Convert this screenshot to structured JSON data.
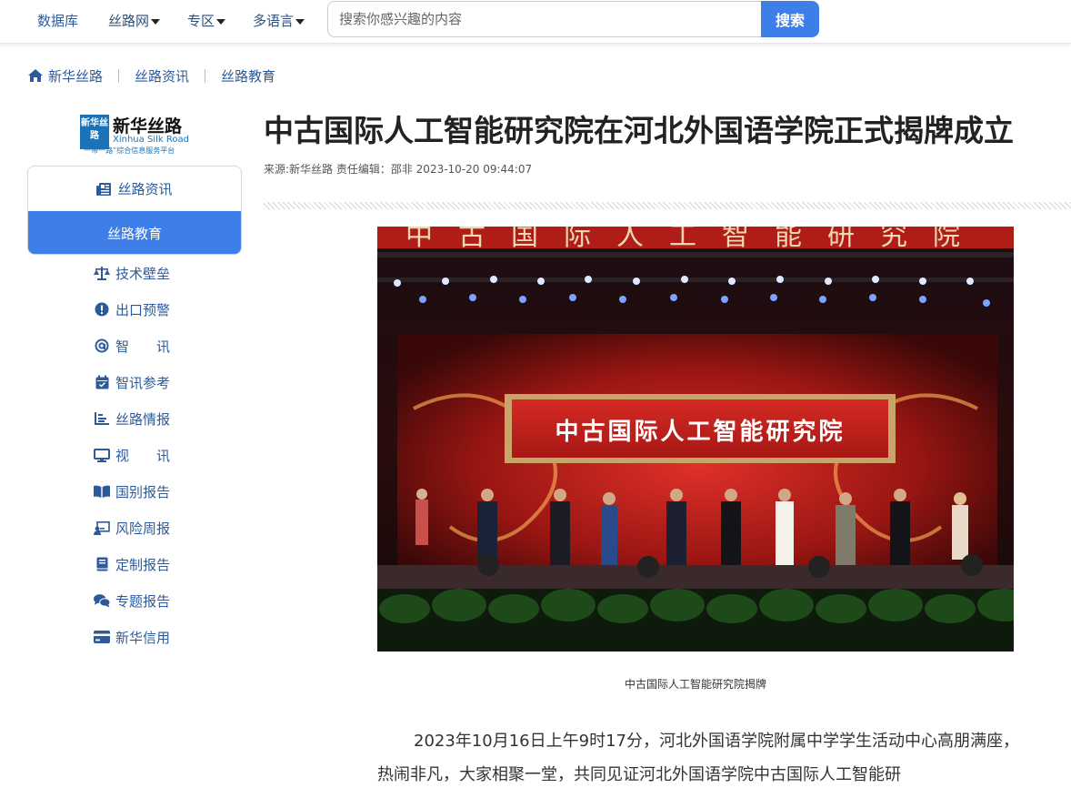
{
  "nav": {
    "database": "数据库",
    "silkroad_net": "丝路网",
    "zone": "专区",
    "multilang": "多语言",
    "search_placeholder": "搜索你感兴趣的内容",
    "search_button": "搜索"
  },
  "breadcrumb": [
    "新华丝路",
    "丝路资讯",
    "丝路教育"
  ],
  "logo": {
    "box_text": "新华丝路",
    "title": "新华丝路",
    "english": "Xinhua Silk Road",
    "slogan": "“一带一路”综合信息服务平台"
  },
  "sidebar": {
    "top_item": "丝路资讯",
    "active_item": "丝路教育",
    "items": [
      {
        "label": "技术壁垒",
        "icon": "scale-icon"
      },
      {
        "label": "出口预警",
        "icon": "alert-icon"
      },
      {
        "label": "智　　讯",
        "icon": "at-icon"
      },
      {
        "label": "智讯参考",
        "icon": "calendar-icon"
      },
      {
        "label": "丝路情报",
        "icon": "bar-chart-icon"
      },
      {
        "label": "视　　讯",
        "icon": "monitor-icon"
      },
      {
        "label": "国别报告",
        "icon": "book-icon"
      },
      {
        "label": "风险周报",
        "icon": "presentation-icon"
      },
      {
        "label": "定制报告",
        "icon": "notebook-icon"
      },
      {
        "label": "专题报告",
        "icon": "comments-icon"
      },
      {
        "label": "新华信用",
        "icon": "credit-card-icon"
      }
    ]
  },
  "article": {
    "title": "中古国际人工智能研究院在河北外国语学院正式揭牌成立",
    "meta": "来源:新华丝路 责任编辑：邵非 2023-10-20 09:44:07",
    "photo_banner_top": "中古国际人工智能研究院",
    "photo_banner": "中古国际人工智能研究院",
    "caption": "中古国际人工智能研究院揭牌",
    "paragraph": "2023年10月16日上午9时17分，河北外国语学院附属中学学生活动中心高朋满座，热闹非凡，大家相聚一堂，共同见证河北外国语学院中古国际人工智能研"
  },
  "colors": {
    "accent": "#3d7ee8",
    "link": "#2d5a9a"
  }
}
